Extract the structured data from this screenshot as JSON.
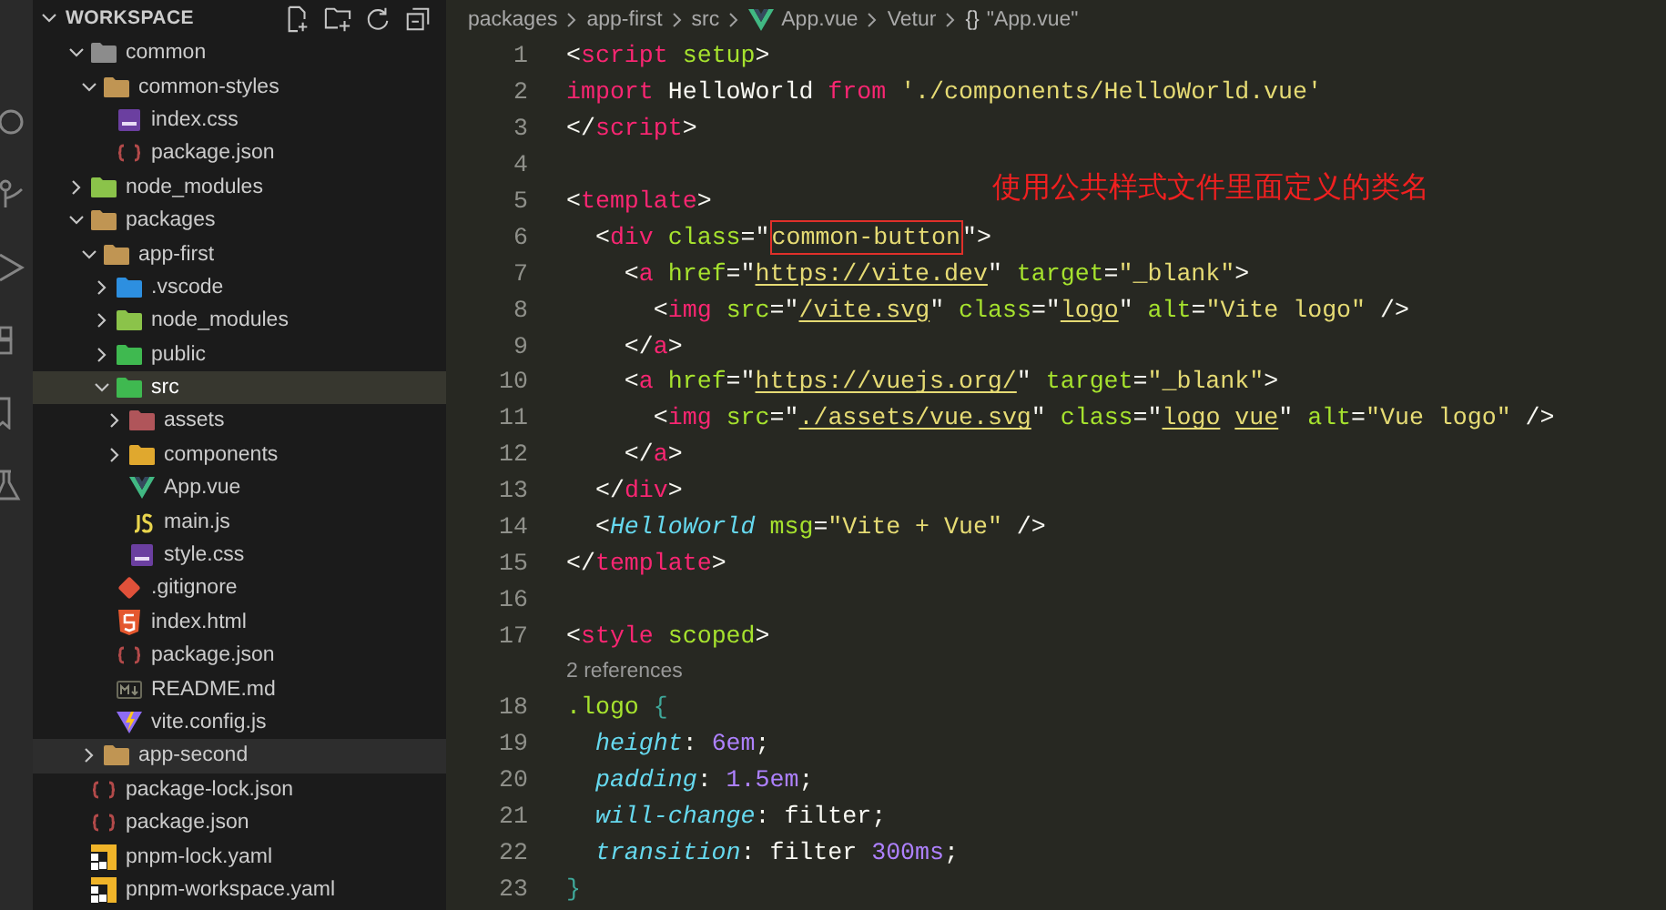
{
  "explorer": {
    "title": "WORKSPACE",
    "tree": [
      {
        "label": "common",
        "kind": "folder-grey",
        "expanded": true,
        "selected": false,
        "hovered": false,
        "children": [
          {
            "label": "common-styles",
            "kind": "folder",
            "expanded": true,
            "selected": false,
            "hovered": false,
            "children": [
              {
                "label": "index.css",
                "kind": "css",
                "selected": false,
                "hovered": false
              },
              {
                "label": "package.json",
                "kind": "json",
                "selected": false,
                "hovered": false
              }
            ]
          }
        ]
      },
      {
        "label": "node_modules",
        "kind": "folder-node",
        "expanded": false,
        "selected": false,
        "hovered": false
      },
      {
        "label": "packages",
        "kind": "folder",
        "expanded": true,
        "selected": false,
        "hovered": false,
        "children": [
          {
            "label": "app-first",
            "kind": "folder",
            "expanded": true,
            "selected": false,
            "hovered": false,
            "children": [
              {
                "label": ".vscode",
                "kind": "folder-blue",
                "expanded": false,
                "selected": false,
                "hovered": false
              },
              {
                "label": "node_modules",
                "kind": "folder-node",
                "expanded": false,
                "selected": false,
                "hovered": false
              },
              {
                "label": "public",
                "kind": "folder-green",
                "expanded": false,
                "selected": false,
                "hovered": false
              },
              {
                "label": "src",
                "kind": "folder-green",
                "expanded": true,
                "selected": true,
                "hovered": false,
                "children": [
                  {
                    "label": "assets",
                    "kind": "folder-red",
                    "expanded": false,
                    "selected": false,
                    "hovered": false
                  },
                  {
                    "label": "components",
                    "kind": "folder-yellow",
                    "expanded": false,
                    "selected": false,
                    "hovered": false
                  },
                  {
                    "label": "App.vue",
                    "kind": "vue",
                    "selected": false,
                    "hovered": false
                  },
                  {
                    "label": "main.js",
                    "kind": "js",
                    "selected": false,
                    "hovered": false
                  },
                  {
                    "label": "style.css",
                    "kind": "css",
                    "selected": false,
                    "hovered": false
                  }
                ]
              },
              {
                "label": ".gitignore",
                "kind": "git",
                "selected": false,
                "hovered": false
              },
              {
                "label": "index.html",
                "kind": "html",
                "selected": false,
                "hovered": false
              },
              {
                "label": "package.json",
                "kind": "json",
                "selected": false,
                "hovered": false
              },
              {
                "label": "README.md",
                "kind": "md",
                "selected": false,
                "hovered": false
              },
              {
                "label": "vite.config.js",
                "kind": "vite",
                "selected": false,
                "hovered": false
              }
            ]
          },
          {
            "label": "app-second",
            "kind": "folder",
            "expanded": false,
            "selected": false,
            "hovered": true
          }
        ]
      },
      {
        "label": "package-lock.json",
        "kind": "json",
        "selected": false,
        "hovered": false
      },
      {
        "label": "package.json",
        "kind": "json",
        "selected": false,
        "hovered": false
      },
      {
        "label": "pnpm-lock.yaml",
        "kind": "yaml",
        "selected": false,
        "hovered": false
      },
      {
        "label": "pnpm-workspace.yaml",
        "kind": "yaml",
        "selected": false,
        "hovered": false
      }
    ]
  },
  "breadcrumbs": [
    {
      "label": "packages",
      "kind": "plain"
    },
    {
      "label": "app-first",
      "kind": "plain"
    },
    {
      "label": "src",
      "kind": "plain"
    },
    {
      "label": "App.vue",
      "kind": "vue"
    },
    {
      "label": "Vetur",
      "kind": "plain"
    },
    {
      "label": "\"App.vue\"",
      "kind": "plain",
      "symbol": "{}"
    }
  ],
  "editor": {
    "lines": [
      {
        "kind": "code",
        "number": "1",
        "tokens": [
          {
            "kind": "punct",
            "text": "<"
          },
          {
            "kind": "tag",
            "text": "script"
          },
          {
            "kind": "attr",
            "text": " setup"
          },
          {
            "kind": "punct",
            "text": ">"
          }
        ]
      },
      {
        "kind": "code",
        "number": "2",
        "tokens": [
          {
            "kind": "keyword",
            "text": "import"
          },
          {
            "kind": "plain",
            "text": " HelloWorld "
          },
          {
            "kind": "keyword",
            "text": "from"
          },
          {
            "kind": "string",
            "text": " './components/HelloWorld.vue'"
          }
        ]
      },
      {
        "kind": "code",
        "number": "3",
        "tokens": [
          {
            "kind": "punct",
            "text": "</"
          },
          {
            "kind": "tag",
            "text": "script"
          },
          {
            "kind": "punct",
            "text": ">"
          }
        ]
      },
      {
        "kind": "code",
        "number": "4"
      },
      {
        "kind": "code",
        "number": "5",
        "tokens": [
          {
            "kind": "punct",
            "text": "<"
          },
          {
            "kind": "tag",
            "text": "template"
          },
          {
            "kind": "punct",
            "text": ">"
          }
        ]
      },
      {
        "kind": "code",
        "number": "6",
        "tokens": [
          {
            "kind": "punct",
            "text": "  <"
          },
          {
            "kind": "tag",
            "text": "div"
          },
          {
            "kind": "attr",
            "text": " class"
          },
          {
            "kind": "punct",
            "text": "=\""
          },
          {
            "kind": "boxed",
            "text": "common-button"
          },
          {
            "kind": "punct",
            "text": "\">"
          }
        ]
      },
      {
        "kind": "code",
        "number": "7",
        "tokens": [
          {
            "kind": "punct",
            "text": "    <"
          },
          {
            "kind": "tag",
            "text": "a"
          },
          {
            "kind": "attr",
            "text": " href"
          },
          {
            "kind": "punct",
            "text": "=\""
          },
          {
            "kind": "link",
            "text": "https://vite.dev"
          },
          {
            "kind": "punct",
            "text": "\""
          },
          {
            "kind": "attr",
            "text": " target"
          },
          {
            "kind": "punct",
            "text": "="
          },
          {
            "kind": "string",
            "text": "\"_blank\""
          },
          {
            "kind": "punct",
            "text": ">"
          }
        ]
      },
      {
        "kind": "code",
        "number": "8",
        "tokens": [
          {
            "kind": "punct",
            "text": "      <"
          },
          {
            "kind": "tag",
            "text": "img"
          },
          {
            "kind": "attr",
            "text": " src"
          },
          {
            "kind": "punct",
            "text": "=\""
          },
          {
            "kind": "link",
            "text": "/vite.svg"
          },
          {
            "kind": "punct",
            "text": "\""
          },
          {
            "kind": "attr",
            "text": " class"
          },
          {
            "kind": "punct",
            "text": "=\""
          },
          {
            "kind": "link",
            "text": "logo"
          },
          {
            "kind": "punct",
            "text": "\""
          },
          {
            "kind": "attr",
            "text": " alt"
          },
          {
            "kind": "punct",
            "text": "="
          },
          {
            "kind": "string",
            "text": "\"Vite logo\""
          },
          {
            "kind": "punct",
            "text": " />"
          }
        ]
      },
      {
        "kind": "code",
        "number": "9",
        "tokens": [
          {
            "kind": "punct",
            "text": "    </"
          },
          {
            "kind": "tag",
            "text": "a"
          },
          {
            "kind": "punct",
            "text": ">"
          }
        ]
      },
      {
        "kind": "code",
        "number": "10",
        "tokens": [
          {
            "kind": "punct",
            "text": "    <"
          },
          {
            "kind": "tag",
            "text": "a"
          },
          {
            "kind": "attr",
            "text": " href"
          },
          {
            "kind": "punct",
            "text": "=\""
          },
          {
            "kind": "link",
            "text": "https://vuejs.org/"
          },
          {
            "kind": "punct",
            "text": "\""
          },
          {
            "kind": "attr",
            "text": " target"
          },
          {
            "kind": "punct",
            "text": "="
          },
          {
            "kind": "string",
            "text": "\"_blank\""
          },
          {
            "kind": "punct",
            "text": ">"
          }
        ]
      },
      {
        "kind": "code",
        "number": "11",
        "tokens": [
          {
            "kind": "punct",
            "text": "      <"
          },
          {
            "kind": "tag",
            "text": "img"
          },
          {
            "kind": "attr",
            "text": " src"
          },
          {
            "kind": "punct",
            "text": "=\""
          },
          {
            "kind": "link",
            "text": "./assets/vue.svg"
          },
          {
            "kind": "punct",
            "text": "\""
          },
          {
            "kind": "attr",
            "text": " class"
          },
          {
            "kind": "punct",
            "text": "=\""
          },
          {
            "kind": "link",
            "text": "logo"
          },
          {
            "kind": "link",
            "text": " vue"
          },
          {
            "kind": "punct",
            "text": "\""
          },
          {
            "kind": "attr",
            "text": " alt"
          },
          {
            "kind": "punct",
            "text": "="
          },
          {
            "kind": "string",
            "text": "\"Vue logo\""
          },
          {
            "kind": "punct",
            "text": " />"
          }
        ]
      },
      {
        "kind": "code",
        "number": "12",
        "tokens": [
          {
            "kind": "punct",
            "text": "    </"
          },
          {
            "kind": "tag",
            "text": "a"
          },
          {
            "kind": "punct",
            "text": ">"
          }
        ]
      },
      {
        "kind": "code",
        "number": "13",
        "tokens": [
          {
            "kind": "punct",
            "text": "  </"
          },
          {
            "kind": "tag",
            "text": "div"
          },
          {
            "kind": "punct",
            "text": ">"
          }
        ]
      },
      {
        "kind": "code",
        "number": "14",
        "tokens": [
          {
            "kind": "punct",
            "text": "  <"
          },
          {
            "kind": "component",
            "text": "HelloWorld"
          },
          {
            "kind": "attr",
            "text": " msg"
          },
          {
            "kind": "punct",
            "text": "="
          },
          {
            "kind": "string",
            "text": "\"Vite + Vue\""
          },
          {
            "kind": "punct",
            "text": " />"
          }
        ]
      },
      {
        "kind": "code",
        "number": "15",
        "tokens": [
          {
            "kind": "punct",
            "text": "</"
          },
          {
            "kind": "tag",
            "text": "template"
          },
          {
            "kind": "punct",
            "text": ">"
          }
        ]
      },
      {
        "kind": "code",
        "number": "16"
      },
      {
        "kind": "code",
        "number": "17",
        "tokens": [
          {
            "kind": "punct",
            "text": "<"
          },
          {
            "kind": "tag",
            "text": "style"
          },
          {
            "kind": "attr",
            "text": " scoped"
          },
          {
            "kind": "punct",
            "text": ">"
          }
        ]
      },
      {
        "kind": "codelens",
        "text": "2 references"
      },
      {
        "kind": "code",
        "number": "18",
        "tokens": [
          {
            "kind": "selector",
            "text": ".logo"
          },
          {
            "kind": "brace",
            "text": " {"
          }
        ]
      },
      {
        "kind": "code",
        "number": "19",
        "tokens": [
          {
            "kind": "property",
            "text": "  height"
          },
          {
            "kind": "punct",
            "text": ": "
          },
          {
            "kind": "number",
            "text": "6em"
          },
          {
            "kind": "punct",
            "text": ";"
          }
        ]
      },
      {
        "kind": "code",
        "number": "20",
        "tokens": [
          {
            "kind": "property",
            "text": "  padding"
          },
          {
            "kind": "punct",
            "text": ": "
          },
          {
            "kind": "number",
            "text": "1.5em"
          },
          {
            "kind": "punct",
            "text": ";"
          }
        ]
      },
      {
        "kind": "code",
        "number": "21",
        "tokens": [
          {
            "kind": "property",
            "text": "  will-change"
          },
          {
            "kind": "punct",
            "text": ": filter;"
          }
        ]
      },
      {
        "kind": "code",
        "number": "22",
        "tokens": [
          {
            "kind": "property",
            "text": "  transition"
          },
          {
            "kind": "punct",
            "text": ": filter "
          },
          {
            "kind": "number",
            "text": "300ms"
          },
          {
            "kind": "punct",
            "text": ";"
          }
        ]
      },
      {
        "kind": "code",
        "number": "23",
        "tokens": [
          {
            "kind": "brace",
            "text": "}"
          }
        ]
      }
    ],
    "annotation": {
      "text": "使用公共样式文件里面定义的类名"
    }
  }
}
